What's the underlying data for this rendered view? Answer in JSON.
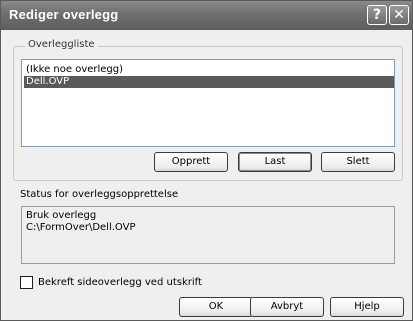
{
  "window": {
    "title": "Rediger overlegg",
    "help_glyph": "?",
    "close_glyph": "✕"
  },
  "overlay_list": {
    "label": "Overleggliste",
    "items": [
      "(Ikke noe overlegg)",
      "Dell.OVP"
    ],
    "selected": "Dell.OVP"
  },
  "list_buttons": {
    "create": "Opprett",
    "load": "Last",
    "delete": "Slett"
  },
  "status": {
    "label": "Status for overleggsopprettelse",
    "lines": [
      "Bruk overlegg",
      "C:\\FormOver\\Dell.OVP"
    ]
  },
  "confirm_checkbox": {
    "label": "Bekreft sideoverlegg ved utskrift",
    "checked": false
  },
  "dialog_buttons": {
    "ok": "OK",
    "cancel": "Avbryt",
    "help": "Hjelp"
  }
}
